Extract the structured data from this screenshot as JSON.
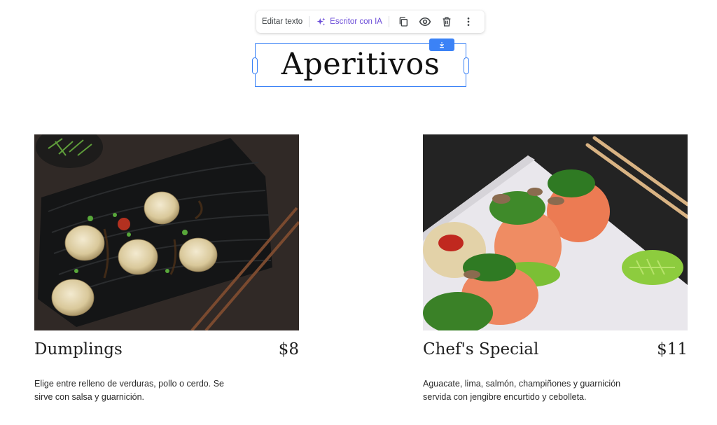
{
  "toolbar": {
    "edit_text": "Editar texto",
    "ai_writer": "Escritor con IA",
    "icons": [
      "sparkle-icon",
      "copy-icon",
      "eye-icon",
      "trash-icon",
      "more-vert-icon",
      "download-icon"
    ]
  },
  "section": {
    "heading": "Aperitivos"
  },
  "items": [
    {
      "name": "Dumplings",
      "price": "$8",
      "description": "Elige entre relleno de verduras, pollo o cerdo. Se sirve con salsa y guarnición."
    },
    {
      "name": "Chef's Special",
      "price": "$11",
      "description": "Aguacate, lima, salmón, champiñones y guarnición servida con jengibre encurtido y cebolleta."
    }
  ],
  "colors": {
    "selection": "#3b82f6",
    "ai_accent": "#6a4bd8",
    "text": "#1f1f1f"
  }
}
